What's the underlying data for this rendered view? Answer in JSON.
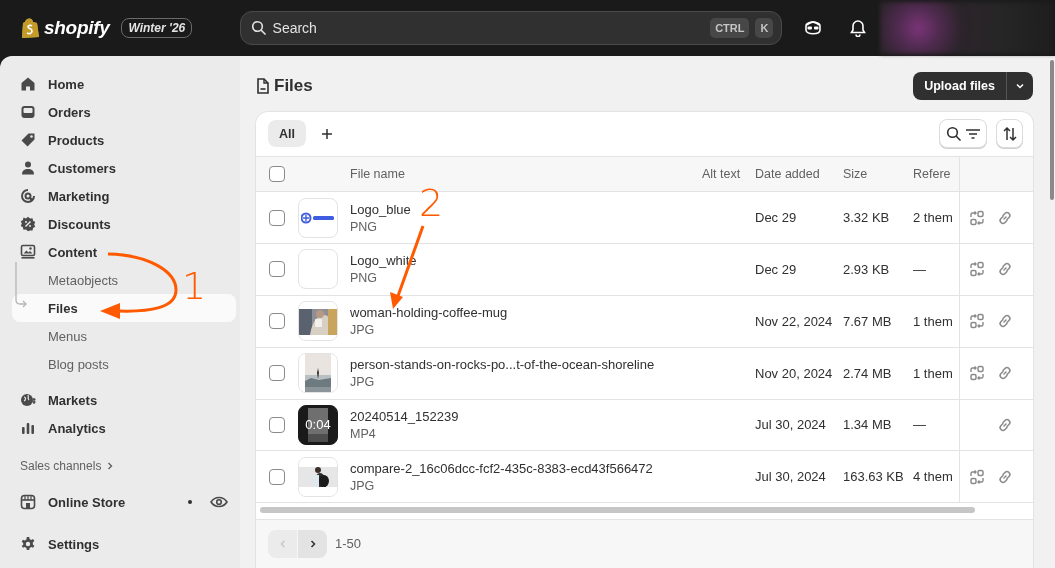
{
  "topbar": {
    "brand": "shopify",
    "edition": "Winter '26",
    "search": {
      "placeholder": "Search",
      "shortcut": [
        "CTRL",
        "K"
      ]
    }
  },
  "sidebar": {
    "items": [
      {
        "label": "Home",
        "selected": false
      },
      {
        "label": "Orders",
        "selected": false
      },
      {
        "label": "Products",
        "selected": false
      },
      {
        "label": "Customers",
        "selected": false
      },
      {
        "label": "Marketing",
        "selected": false
      },
      {
        "label": "Discounts",
        "selected": false
      },
      {
        "label": "Content",
        "selected": false,
        "expanded": true,
        "children": [
          {
            "label": "Metaobjects",
            "selected": false
          },
          {
            "label": "Files",
            "selected": true
          },
          {
            "label": "Menus",
            "selected": false
          },
          {
            "label": "Blog posts",
            "selected": false
          }
        ]
      },
      {
        "label": "Markets",
        "selected": false
      },
      {
        "label": "Analytics",
        "selected": false
      }
    ],
    "sales_channels": {
      "label": "Sales channels",
      "items": [
        {
          "label": "Online Store",
          "selected": false
        }
      ]
    },
    "settings": {
      "label": "Settings",
      "selected": false
    }
  },
  "page": {
    "title": "Files",
    "upload_button": "Upload files",
    "tabs": [
      {
        "label": "All",
        "selected": true
      }
    ],
    "columns": [
      "File name",
      "Alt text",
      "Date added",
      "Size",
      "Refere"
    ],
    "header_checked": false,
    "rows": [
      {
        "name": "Logo_blue",
        "type": "PNG",
        "date": "Dec 29",
        "size": "3.32 KB",
        "references": "2 them",
        "thumbnail": {
          "kind": "logo"
        },
        "checked": false,
        "replaceable": true
      },
      {
        "name": "Logo_white",
        "type": "PNG",
        "date": "Dec 29",
        "size": "2.93 KB",
        "references": "—",
        "thumbnail": {
          "kind": "blank"
        },
        "checked": false,
        "replaceable": true
      },
      {
        "name": "woman-holding-coffee-mug",
        "type": "JPG",
        "date": "Nov 22, 2024",
        "size": "7.67 MB",
        "references": "1 them",
        "checked": false,
        "replaceable": true
      },
      {
        "name": "person-stands-on-rocks-po...t-of-the-ocean-shoreline",
        "type": "JPG",
        "date": "Nov 20, 2024",
        "size": "2.74 MB",
        "references": "1 them",
        "checked": false,
        "replaceable": true
      },
      {
        "name": "20240514_152239",
        "type": "MP4",
        "date": "Jul 30, 2024",
        "size": "1.34 MB",
        "references": "—",
        "thumbnail": {
          "kind": "video",
          "duration": "0:04"
        },
        "checked": false,
        "replaceable": false
      },
      {
        "name": "compare-2_16c06dcc-fcf2-435c-8383-ecd43f566472",
        "type": "JPG",
        "date": "Jul 30, 2024",
        "size": "163.63 KB",
        "references": "4 them",
        "checked": false,
        "replaceable": true
      }
    ],
    "pagination": {
      "range": "1-50",
      "previous_disabled": true,
      "next_disabled": false
    }
  },
  "annotations": [
    {
      "label": "1"
    },
    {
      "label": "2"
    }
  ]
}
